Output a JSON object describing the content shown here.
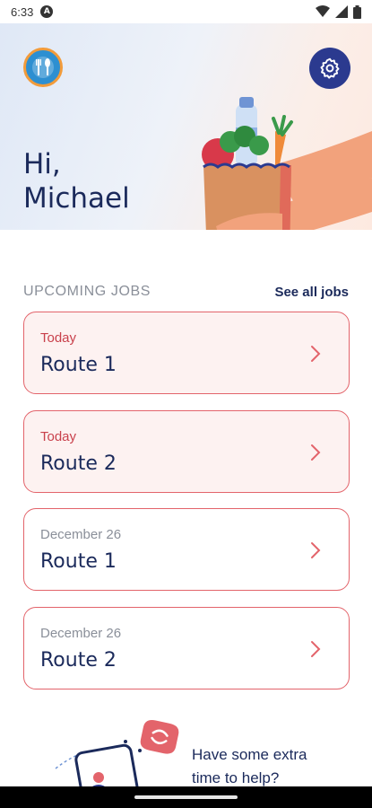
{
  "status_bar": {
    "time": "6:33"
  },
  "header": {
    "greeting_line1": "Hi,",
    "greeting_line2": "Michael"
  },
  "upcoming": {
    "title": "UPCOMING JOBS",
    "see_all": "See all jobs",
    "jobs": [
      {
        "date": "Today",
        "route": "Route 1"
      },
      {
        "date": "Today",
        "route": "Route 2"
      },
      {
        "date": "December 26",
        "route": "Route 1"
      },
      {
        "date": "December 26",
        "route": "Route 2"
      }
    ]
  },
  "promo": {
    "line1": "Have some extra",
    "line2": "time to help?"
  },
  "colors": {
    "navy": "#1b2a5b",
    "accent_red": "#e3646b",
    "today_text": "#c9414c",
    "settings_bg": "#2b3a8f"
  },
  "icons": [
    "wifi-icon",
    "signal-icon",
    "battery-icon",
    "settings-gear-icon",
    "chevron-right-icon",
    "logo-icon"
  ]
}
